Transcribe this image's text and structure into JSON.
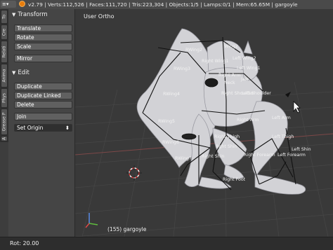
{
  "header": {
    "editor_menu_icon": "info-editor-icon",
    "stats": "v2.79 | Verts:112,526 | Faces:111,720 | Tris:223,304 | Objects:1/5 | Lamps:0/1 | Mem:65.65M | gargoyle"
  },
  "side_tabs": [
    "To",
    "Cre",
    "Relati",
    "Anima",
    "Phys",
    "Grease P",
    "A"
  ],
  "toolshelf": {
    "transform": {
      "title": "Transform",
      "buttons": [
        "Translate",
        "Rotate",
        "Scale",
        "Mirror"
      ]
    },
    "edit": {
      "title": "Edit",
      "buttons": [
        "Duplicate",
        "Duplicate Linked",
        "Delete",
        "Join"
      ],
      "set_origin": "Set Origin"
    }
  },
  "viewport": {
    "view_name": "User Ortho",
    "frame_label": "(155) gargoyle",
    "bones": [
      "RWing2",
      "Wing2",
      "Left Wing2",
      "Right Wing1",
      "Left Wing1",
      "RWing3",
      "Right Arm",
      "Jaw",
      "Neck",
      "Right Shoulder",
      "RWing4",
      "Left Shoulder",
      "Left Arm",
      "RWing5",
      "Right Arm",
      "Right Thigh",
      "Left Thigh",
      "Rght Shin",
      "RWing6",
      "Right Forearm",
      "Left Forearm",
      "Left Shin",
      "RWing7",
      "Right Shin",
      "Right Foot"
    ]
  },
  "status": {
    "rotation": "Rot: 20.00"
  },
  "colors": {
    "header_bg": "#4a4a4a",
    "panel_bg": "#454545",
    "viewport_bg": "#393939",
    "button_bg": "#606060",
    "logo": "#e87d0d"
  }
}
